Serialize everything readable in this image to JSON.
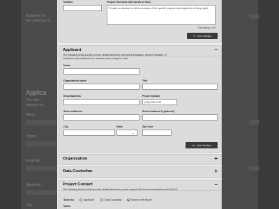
{
  "background": {
    "left_text_1": "Guidance for",
    "left_text_2": "the collection of...",
    "left_title": "Applica",
    "left_lines": [
      "The follo...",
      "research te...",
      "Name",
      "Organi...",
      "Email Ad...",
      "Street Ad...",
      "City"
    ]
  },
  "top_card": {
    "number_label": "Number",
    "overview_label": "Project Overview (150 words or less)",
    "overview_value": "Provide an abstract or brief summary of the specific purpose and objectives of this project.",
    "remaining": "Remaining: 150",
    "next_button": "Next Section"
  },
  "applicant": {
    "title": "Applicant",
    "toggle": "−",
    "description": "The following fields should provide details about the principal investigator, project manager, or individual responsible for the research team using the data.",
    "name_label": "Name",
    "org_label": "Organization Name",
    "title_label": "Title",
    "email_label": "Email Address",
    "phone_label": "Phone Number",
    "phone_placeholder": "(240) 555 1234",
    "street1_label": "Street Address I",
    "street2_label": "Street Address 2 (optional)",
    "city_label": "City",
    "state_label": "State",
    "zip_label": "Zip Code",
    "next_button": "Next Section"
  },
  "organization": {
    "title": "Organization",
    "toggle": "+"
  },
  "custodian": {
    "title": "Data Custodian",
    "toggle": "+"
  },
  "contact": {
    "title": "Project Contact",
    "toggle": "−",
    "description": "The following fields should provide details about the person responsible for communications with ANCC.",
    "same_as_label": "Same as:",
    "options": [
      "Applicant",
      "Data Custodian",
      "None of the Above"
    ],
    "selected": 2,
    "name_label": "Name"
  }
}
